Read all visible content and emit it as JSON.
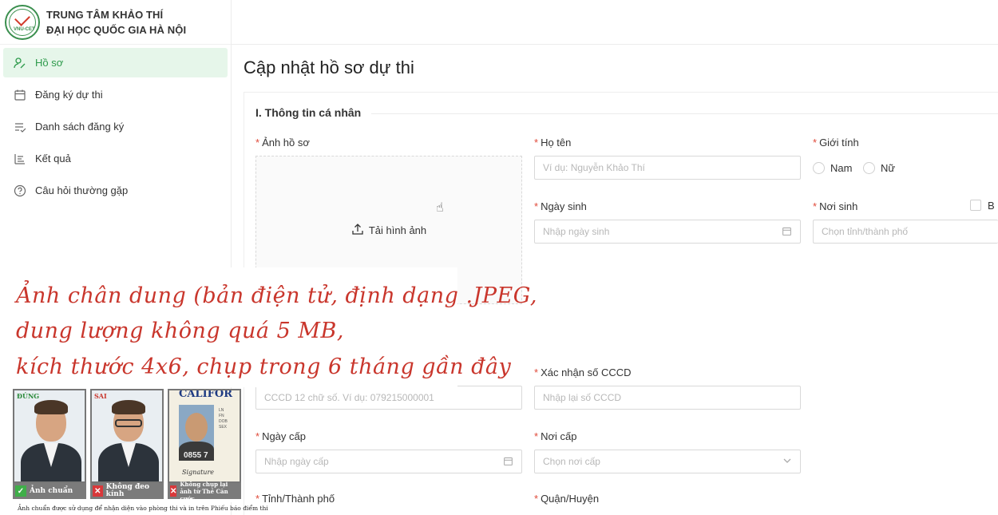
{
  "org": {
    "line1": "TRUNG TÂM KHẢO THÍ",
    "line2": "ĐẠI HỌC QUỐC GIA HÀ NỘI",
    "logo_text": "VNU-CET"
  },
  "sidebar": {
    "items": [
      {
        "label": "Hồ sơ",
        "icon": "user-edit-icon",
        "active": true
      },
      {
        "label": "Đăng ký dự thi",
        "icon": "calendar-icon",
        "active": false
      },
      {
        "label": "Danh sách đăng ký",
        "icon": "list-check-icon",
        "active": false
      },
      {
        "label": "Kết quả",
        "icon": "bar-chart-icon",
        "active": false
      },
      {
        "label": "Câu hỏi thường gặp",
        "icon": "question-circle-icon",
        "active": false
      }
    ]
  },
  "page": {
    "title": "Cập nhật hồ sơ dự thi"
  },
  "form": {
    "section1": "I. Thông tin cá nhân",
    "photo_label": "Ảnh hồ sơ",
    "upload_label": "Tải hình ảnh",
    "fullname_label": "Họ tên",
    "fullname_placeholder": "Ví dụ: Nguyễn Khảo Thí",
    "gender_label": "Giới tính",
    "gender_options": [
      "Nam",
      "Nữ"
    ],
    "dob_label": "Ngày sinh",
    "dob_placeholder": "Nhập ngày sinh",
    "birthplace_label": "Nơi sinh",
    "birthplace_placeholder": "Chọn tỉnh/thành phố",
    "birthplace_checkbox_label": "B",
    "cccd_placeholder": "CCCD 12 chữ số. Ví dụ: 079215000001",
    "cccd_confirm_label": "Xác nhận số CCCD",
    "cccd_confirm_placeholder": "Nhập lại số CCCD",
    "issue_date_label": "Ngày cấp",
    "issue_date_placeholder": "Nhập ngày cấp",
    "issue_place_label": "Nơi cấp",
    "issue_place_placeholder": "Chọn nơi cấp",
    "province_label": "Tỉnh/Thành phố",
    "district_label": "Quận/Huyện"
  },
  "overlay": {
    "line1": "Ảnh chân dung (bản điện tử, định dạng .JPEG,",
    "line2": "dung lượng không quá 5 MB,",
    "line3": "kích thước 4x6, chụp trong 6 tháng gần đây"
  },
  "photo_guide": {
    "tag_ok": "ĐÚNG",
    "tag_bad": "SAI",
    "card_header": "CALIFOR",
    "card_number": "0855 7",
    "card_signature": "Signature",
    "caption_ok": "Ảnh chuẩn",
    "caption_glasses": "Không đeo kính",
    "caption_card": "Không chụp lại ảnh từ Thẻ Căn cước",
    "note": "Ảnh chuẩn được sử dụng để nhận diện vào phòng thi và in trên Phiếu báo điểm thi"
  },
  "colors": {
    "accent": "#2d9a4b",
    "active_bg": "#e6f6ea",
    "overlay_text": "#c9362c",
    "required": "#e04a3a"
  }
}
